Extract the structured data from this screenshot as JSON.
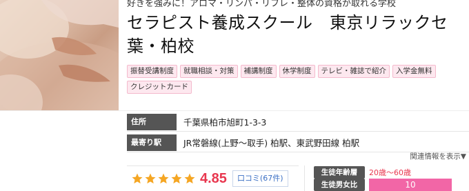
{
  "tagline": "好きを強みに！アロマ・リンパ・リフレ・整体の資格が取れる学校",
  "school_name": "セラピスト養成スクール　東京リラックセ葉・柏校",
  "tags": [
    "振替受講制度",
    "就職相談・対策",
    "補講制度",
    "休学制度",
    "テレビ・雑誌で紹介",
    "入学金無料",
    "クレジットカード"
  ],
  "info": {
    "address_label": "住所",
    "address_value": "千葉県柏市旭町1-3-3",
    "station_label": "最寄り駅",
    "station_value": "JR常磐線(上野～取手) 柏駅、東武野田線 柏駅"
  },
  "related_link": "関連情報を表示▼",
  "rating": {
    "stars": 5,
    "score": "4.85",
    "kuchikomi": "口コミ(67件)"
  },
  "students": {
    "age_label": "生徒年齢層",
    "age_value": "20歳～60歳",
    "ratio_label": "生徒男女比",
    "ratio_value": "10"
  },
  "colors": {
    "accent": "#e8374f",
    "tag_bg": "#fde8ef",
    "tag_border": "#f4b9cc",
    "label_bg": "#555555",
    "ratio_bar": "#f266a6",
    "star": "#f5a623"
  },
  "icons": {
    "photo": "massage-photo",
    "star": "star-icon"
  }
}
